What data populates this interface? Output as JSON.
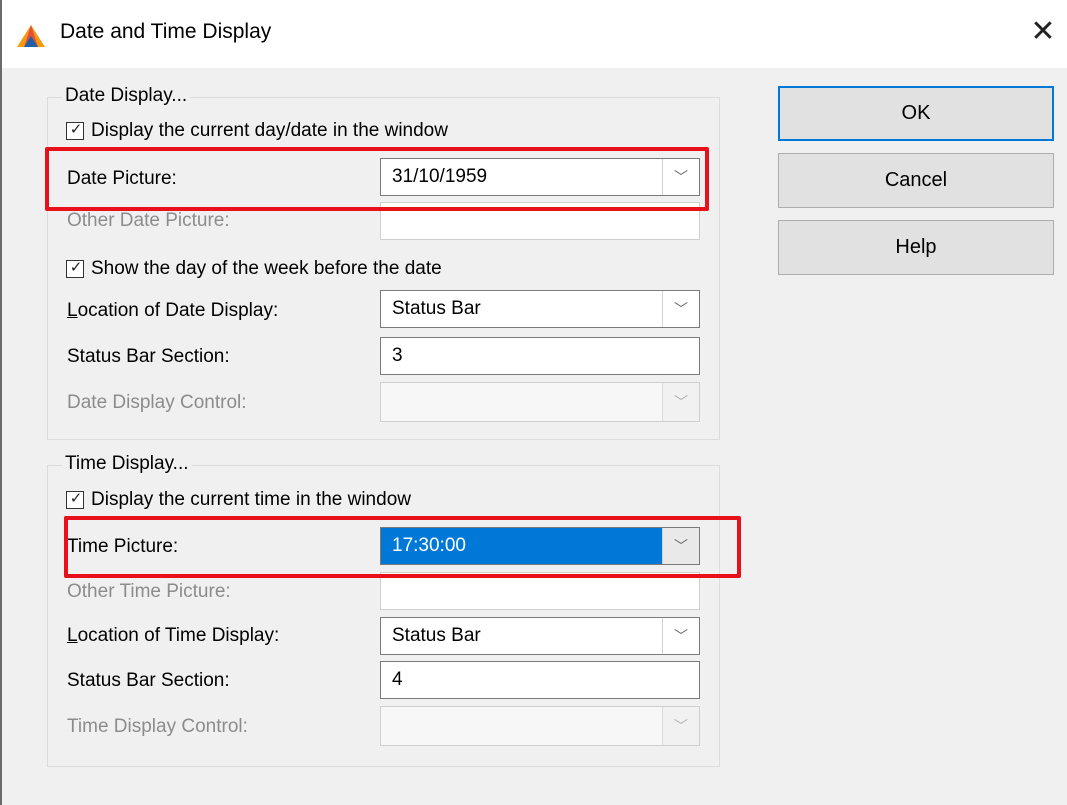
{
  "window": {
    "title": "Date and Time Display",
    "app_icon": "app-logo-icon",
    "close_glyph": "✕"
  },
  "date_group": {
    "legend": "Date Display...",
    "display_checkbox": {
      "label": "Display the current day/date in the window",
      "checked": true
    },
    "date_picture": {
      "label": "Date Picture:",
      "value": "31/10/1959"
    },
    "other_date_picture": {
      "label": "Other Date Picture:",
      "value": ""
    },
    "show_day_checkbox": {
      "label": "Show the day of the week before the date",
      "checked": true
    },
    "location": {
      "label_underlined": "L",
      "label_rest": "ocation of Date Display:",
      "value": "Status Bar"
    },
    "status_bar_section": {
      "label": "Status Bar Section:",
      "value": "3"
    },
    "display_control": {
      "label": "Date Display Control:",
      "value": ""
    }
  },
  "time_group": {
    "legend": "Time Display...",
    "display_checkbox": {
      "label": "Display the current time in the window",
      "checked": true
    },
    "time_picture": {
      "label": "Time Picture:",
      "value": "17:30:00"
    },
    "other_time_picture": {
      "label": "Other Time Picture:",
      "value": ""
    },
    "location": {
      "label_underlined": "L",
      "label_rest": "ocation of Time Display:",
      "value": "Status Bar"
    },
    "status_bar_section": {
      "label": "Status Bar Section:",
      "value": "4"
    },
    "display_control": {
      "label": "Time Display Control:",
      "value": ""
    }
  },
  "buttons": {
    "ok": "OK",
    "cancel": "Cancel",
    "help": "Help"
  },
  "colors": {
    "highlight_box": "#e8101a",
    "selection": "#0078d7"
  }
}
